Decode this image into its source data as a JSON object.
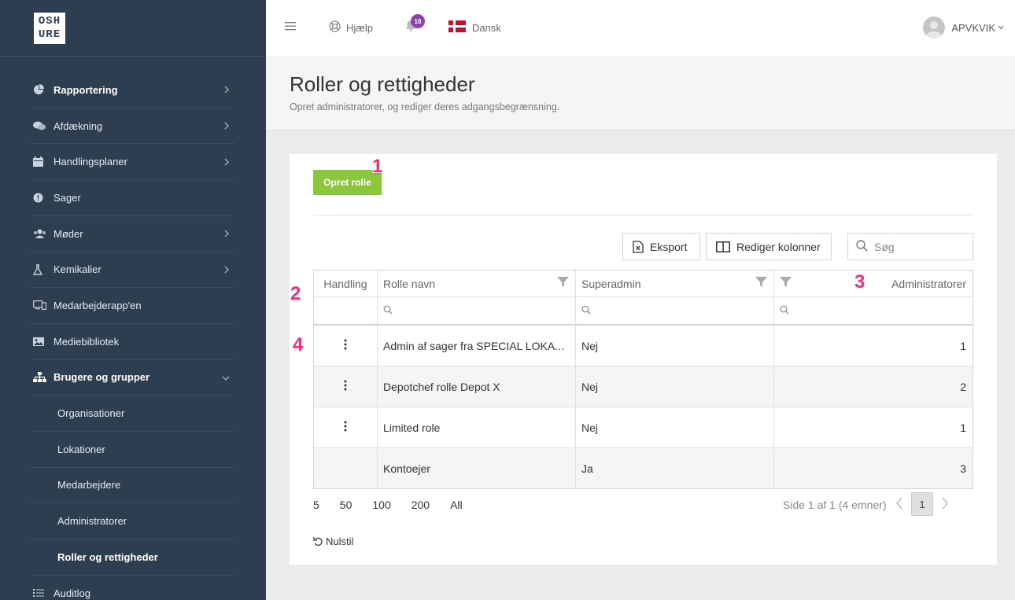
{
  "brand": {
    "logo_line1": "OSH",
    "logo_line2": "URE"
  },
  "sidebar": {
    "items": [
      {
        "label": "Rapportering",
        "icon": "pie-chart-icon",
        "bold": true,
        "chevron": "right"
      },
      {
        "label": "Afdækning",
        "icon": "chat-bubbles-icon",
        "bold": false,
        "chevron": "right"
      },
      {
        "label": "Handlingsplaner",
        "icon": "calendar-icon",
        "bold": false,
        "chevron": "right"
      },
      {
        "label": "Sager",
        "icon": "exclamation-circle-icon",
        "bold": false,
        "chevron": ""
      },
      {
        "label": "Møder",
        "icon": "people-icon",
        "bold": false,
        "chevron": "right"
      },
      {
        "label": "Kemikalier",
        "icon": "flask-icon",
        "bold": false,
        "chevron": "right"
      },
      {
        "label": "Medarbejderapp'en",
        "icon": "devices-icon",
        "bold": false,
        "chevron": ""
      },
      {
        "label": "Mediebibliotek",
        "icon": "image-icon",
        "bold": false,
        "chevron": ""
      },
      {
        "label": "Brugere og grupper",
        "icon": "org-chart-icon",
        "bold": true,
        "chevron": "down"
      }
    ],
    "subitems": [
      {
        "label": "Organisationer",
        "active": false
      },
      {
        "label": "Lokationer",
        "active": false
      },
      {
        "label": "Medarbejdere",
        "active": false
      },
      {
        "label": "Administratorer",
        "active": false
      },
      {
        "label": "Roller og rettigheder",
        "active": true
      }
    ],
    "last_item": {
      "label": "Auditlog",
      "icon": "list-icon"
    }
  },
  "topbar": {
    "help_label": "Hjælp",
    "notification_count": "18",
    "language_label": "Dansk",
    "user_label": "APVKVIK"
  },
  "page": {
    "title": "Roller og rettigheder",
    "subtitle": "Opret administratorer, og rediger deres adgangsbegrænsning."
  },
  "toolbar": {
    "create_label": "Opret rolle",
    "export_label": "Eksport",
    "columns_label": "Rediger kolonner",
    "search_placeholder": "Søg"
  },
  "table": {
    "headers": [
      "Handling",
      "Rolle navn",
      "Superadmin",
      "Administratorer"
    ],
    "rows": [
      {
        "has_menu": true,
        "role": "Admin af sager fra SPECIAL LOKATION",
        "superadmin": "Nej",
        "admins": "1"
      },
      {
        "has_menu": true,
        "role": "Depotchef rolle Depot X",
        "superadmin": "Nej",
        "admins": "2"
      },
      {
        "has_menu": true,
        "role": "Limited role",
        "superadmin": "Nej",
        "admins": "1"
      },
      {
        "has_menu": false,
        "role": "Kontoejer",
        "superadmin": "Ja",
        "admins": "3"
      }
    ]
  },
  "pager": {
    "sizes": [
      "5",
      "50",
      "100",
      "200",
      "All"
    ],
    "info": "Side 1 af 1 (4 emner)",
    "current_page": "1",
    "reset_label": "Nulstil"
  },
  "annotations": [
    "1",
    "2",
    "3",
    "4"
  ],
  "colors": {
    "sidebar_bg": "#2c3e50",
    "primary_button": "#8cc63f",
    "badge": "#8e44ad",
    "annotation": "#e8307a"
  }
}
